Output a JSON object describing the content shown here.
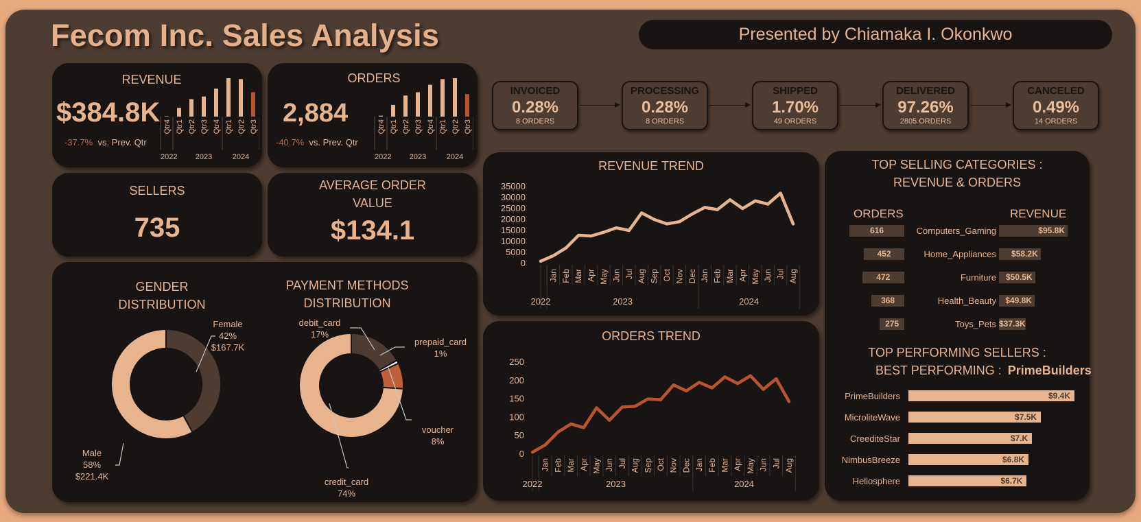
{
  "header": {
    "title": "Fecom Inc. Sales Analysis",
    "presenter": "Presented by Chiamaka I. Okonkwo"
  },
  "colors": {
    "peach": "#e8b48e",
    "rust": "#b8552e",
    "dark": "#181414",
    "brown": "#4d3c31"
  },
  "kpis": {
    "revenue": {
      "label": "REVENUE",
      "value": "$384.8K",
      "change": "-37.7%",
      "change_label": "vs. Prev. Qtr"
    },
    "orders": {
      "label": "ORDERS",
      "value": "2,884",
      "change": "-40.7%",
      "change_label": "vs. Prev. Qtr"
    },
    "sellers": {
      "label": "SELLERS",
      "value": "735"
    },
    "aov": {
      "label1": "AVERAGE ORDER",
      "label2": "VALUE",
      "value": "$134.1"
    }
  },
  "sparkline_axis": {
    "quarters": [
      "Qtr4",
      "Qtr1",
      "Qtr2",
      "Qtr3",
      "Qtr4",
      "Qtr1",
      "Qtr2",
      "Qtr3"
    ],
    "years": [
      "2022",
      "2023",
      "2024"
    ]
  },
  "status": [
    {
      "name": "INVOICED",
      "pct": "0.28%",
      "orders": "8 ORDERS"
    },
    {
      "name": "PROCESSING",
      "pct": "0.28%",
      "orders": "8 ORDERS"
    },
    {
      "name": "SHIPPED",
      "pct": "1.70%",
      "orders": "49 ORDERS"
    },
    {
      "name": "DELIVERED",
      "pct": "97.26%",
      "orders": "2805 ORDERS"
    },
    {
      "name": "CANCELED",
      "pct": "0.49%",
      "orders": "14 ORDERS"
    }
  ],
  "gender": {
    "title1": "GENDER",
    "title2": "DISTRIBUTION",
    "female": {
      "name": "Female",
      "pct": "42%",
      "value": "$167.7K"
    },
    "male": {
      "name": "Male",
      "pct": "58%",
      "value": "$221.4K"
    }
  },
  "payment": {
    "title1": "PAYMENT METHODS",
    "title2": "DISTRIBUTION",
    "debit": {
      "name": "debit_card",
      "pct": "17%"
    },
    "prepaid": {
      "name": "prepaid_card",
      "pct": "1%"
    },
    "voucher": {
      "name": "voucher",
      "pct": "8%"
    },
    "credit": {
      "name": "credit_card",
      "pct": "74%"
    }
  },
  "revenue_trend": {
    "title": "REVENUE TREND"
  },
  "orders_trend": {
    "title": "ORDERS TREND"
  },
  "categories": {
    "title1": "TOP SELLING CATEGORIES :",
    "title2": "REVENUE & ORDERS",
    "orders_header": "ORDERS",
    "revenue_header": "REVENUE",
    "items": [
      {
        "name": "Computers_Gaming",
        "orders": "616",
        "revenue": "$95.8K",
        "orders_num": 616,
        "revenue_num": 95.8
      },
      {
        "name": "Home_Appliances",
        "orders": "452",
        "revenue": "$58.2K",
        "orders_num": 452,
        "revenue_num": 58.2
      },
      {
        "name": "Furniture",
        "orders": "472",
        "revenue": "$50.5K",
        "orders_num": 472,
        "revenue_num": 50.5
      },
      {
        "name": "Health_Beauty",
        "orders": "368",
        "revenue": "$49.8K",
        "orders_num": 368,
        "revenue_num": 49.8
      },
      {
        "name": "Toys_Pets",
        "orders": "275",
        "revenue": "$37.3K",
        "orders_num": 275,
        "revenue_num": 37.3
      }
    ]
  },
  "sellers_section": {
    "title1": "TOP PERFORMING SELLERS :",
    "best_label": "BEST PERFORMING :",
    "best_name": "PrimeBuilders",
    "items": [
      {
        "name": "PrimeBuilders",
        "value": "$9.4K",
        "num": 9.4
      },
      {
        "name": "MicroliteWave",
        "value": "$7.5K",
        "num": 7.5
      },
      {
        "name": "CreediteStar",
        "value": "$7.K",
        "num": 7.0
      },
      {
        "name": "NimbusBreeze",
        "value": "$6.8K",
        "num": 6.8
      },
      {
        "name": "Heliosphere",
        "value": "$6.7K",
        "num": 6.7
      }
    ]
  },
  "chart_data": [
    {
      "type": "bar",
      "categories": [
        "2022 Qtr4",
        "2023 Qtr1",
        "2023 Qtr2",
        "2023 Qtr3",
        "2023 Qtr4",
        "2024 Qtr1",
        "2024 Qtr2",
        "2024 Qtr3"
      ],
      "values": [
        1,
        20,
        40,
        46,
        64,
        88,
        86,
        56
      ],
      "highlight_last": true
    },
    {
      "type": "bar",
      "categories": [
        "2022 Qtr4",
        "2023 Qtr1",
        "2023 Qtr2",
        "2023 Qtr3",
        "2023 Qtr4",
        "2024 Qtr1",
        "2024 Qtr2",
        "2024 Qtr3"
      ],
      "values": [
        2,
        25,
        45,
        52,
        68,
        80,
        82,
        48
      ],
      "highlight_last": true
    },
    {
      "type": "line",
      "title": "REVENUE TREND",
      "months": [
        "Jan",
        "Feb",
        "Mar",
        "Apr",
        "May",
        "Jun",
        "Jul",
        "Aug",
        "Sep",
        "Oct",
        "Nov",
        "Dec",
        "Jan",
        "Feb",
        "Mar",
        "Apr",
        "May",
        "Jun",
        "Jul",
        "Aug"
      ],
      "years": [
        "2022",
        "2023",
        "2024"
      ],
      "values": [
        1000,
        3500,
        7000,
        12800,
        12500,
        14200,
        16200,
        15000,
        23000,
        20000,
        18000,
        19000,
        22500,
        25500,
        24500,
        29000,
        25000,
        28500,
        27000,
        32000,
        18000
      ],
      "ylim": [
        0,
        35000
      ],
      "yticks": [
        0,
        5000,
        10000,
        15000,
        20000,
        25000,
        30000,
        35000
      ]
    },
    {
      "type": "line",
      "title": "ORDERS TREND",
      "months": [
        "Jan",
        "Feb",
        "Mar",
        "Apr",
        "May",
        "Jun",
        "Jul",
        "Aug",
        "Sep",
        "Oct",
        "Nov",
        "Dec",
        "Jan",
        "Feb",
        "Mar",
        "Apr",
        "May",
        "Jun",
        "Jul",
        "Aug"
      ],
      "years": [
        "2022",
        "2023",
        "2024"
      ],
      "values": [
        5,
        25,
        60,
        82,
        72,
        126,
        92,
        128,
        130,
        150,
        148,
        188,
        172,
        195,
        180,
        210,
        192,
        213,
        176,
        205,
        143
      ],
      "ylim": [
        0,
        250
      ],
      "yticks": [
        0,
        50,
        100,
        150,
        200,
        250
      ]
    },
    {
      "type": "pie",
      "title": "GENDER DISTRIBUTION",
      "labels": [
        "Female",
        "Male"
      ],
      "values": [
        42,
        58
      ]
    },
    {
      "type": "pie",
      "title": "PAYMENT METHODS DISTRIBUTION",
      "labels": [
        "debit_card",
        "prepaid_card",
        "voucher",
        "credit_card"
      ],
      "values": [
        17,
        1,
        8,
        74
      ]
    }
  ]
}
